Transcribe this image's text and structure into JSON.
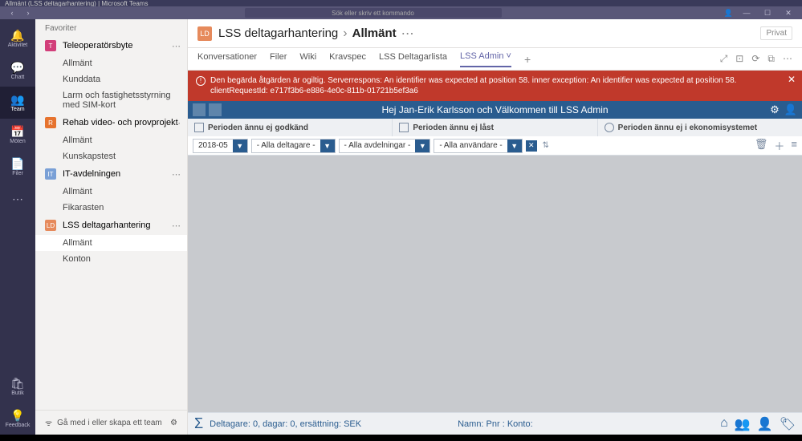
{
  "window": {
    "title": "Allmänt (LSS deltagarhantering) | Microsoft Teams"
  },
  "search": {
    "placeholder": "Sök eller skriv ett kommando"
  },
  "rail": {
    "items": [
      {
        "icon": "🔔",
        "label": "Aktivitet"
      },
      {
        "icon": "💬",
        "label": "Chatt"
      },
      {
        "icon": "👥",
        "label": "Team"
      },
      {
        "icon": "📅",
        "label": "Möten"
      },
      {
        "icon": "📄",
        "label": "Filer"
      },
      {
        "icon": "⋯",
        "label": ""
      }
    ],
    "bottom": [
      {
        "icon": "🛍",
        "label": "Butik"
      },
      {
        "icon": "💡",
        "label": "Feedback"
      }
    ]
  },
  "sidebar": {
    "favoriter": "Favoriter",
    "teams": [
      {
        "name": "Teleoperatörsbyte",
        "color": "#d23f7a",
        "initial": "T",
        "channels": [
          "Allmänt",
          "Kunddata",
          "Larm och fastighetsstyrning med SIM-kort"
        ]
      },
      {
        "name": "Rehab video- och provprojekt",
        "color": "#e6732e",
        "initial": "R",
        "channels": [
          "Allmänt",
          "Kunskapstest"
        ]
      },
      {
        "name": "IT-avdelningen",
        "color": "#7aa0d6",
        "initial": "IT",
        "channels": [
          "Allmänt",
          "Fikarasten"
        ]
      },
      {
        "name": "LSS deltagarhantering",
        "color": "#e68a5c",
        "initial": "LD",
        "channels": [
          "Allmänt",
          "Konton"
        ]
      }
    ],
    "join": "Gå med i eller skapa ett team"
  },
  "header": {
    "icon_initial": "LD",
    "team": "LSS deltagarhantering",
    "channel": "Allmänt",
    "privat": "Privat"
  },
  "tabs": {
    "items": [
      "Konversationer",
      "Filer",
      "Wiki",
      "Kravspec",
      "LSS Deltagarlista",
      "LSS Admin"
    ],
    "active": "LSS Admin"
  },
  "error": {
    "text": "Den begärda åtgärden är ogiltig. Serverrespons: An identifier was expected at position 58. inner exception: An identifier was expected at position 58. clientRequestId: e717f3b6-e886-4e0c-811b-01721b5ef3a6"
  },
  "app": {
    "welcome": "Hej Jan-Erik Karlsson och Välkommen till LSS Admin",
    "status": {
      "a": "Perioden ännu ej godkänd",
      "b": "Perioden ännu ej låst",
      "c": "Perioden ännu ej i ekonomisystemet"
    },
    "filters": {
      "period": "2018-05",
      "deltagare": "- Alla deltagare -",
      "avdelningar": "- Alla avdelningar -",
      "anvandare": "- Alla användare -"
    },
    "footer": {
      "left": "Deltagare: 0, dagar: 0, ersättning: SEK",
      "mid": "Namn: Pnr : Konto:"
    }
  }
}
